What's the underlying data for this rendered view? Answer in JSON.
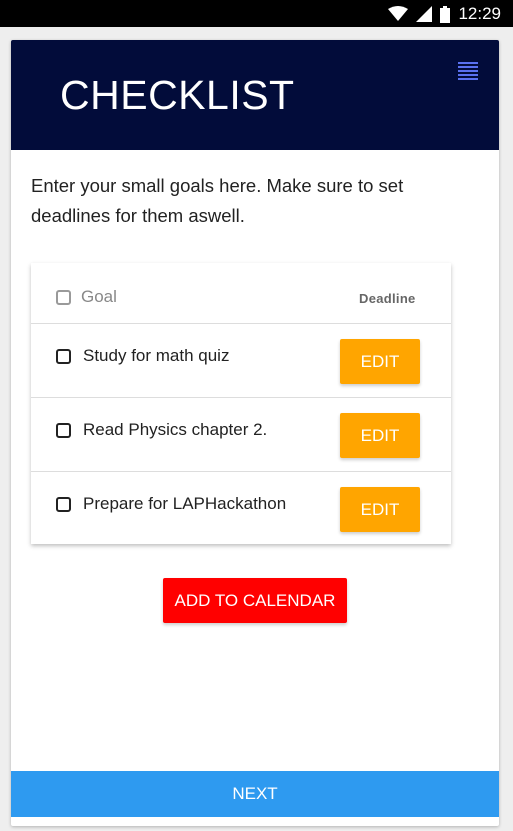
{
  "status_bar": {
    "time": "12:29",
    "icons": [
      "wifi-icon",
      "signal-icon",
      "battery-icon"
    ]
  },
  "app": {
    "title": "CHECKLIST",
    "menu_icon": "menu-icon"
  },
  "intro_text": "Enter your small goals here. Make sure to set deadlines for them aswell.",
  "table": {
    "goal_header": "Goal",
    "deadline_header": "Deadline",
    "rows": [
      {
        "goal": "Study for math quiz",
        "action": "EDIT"
      },
      {
        "goal": "Read Physics chapter 2.",
        "action": "EDIT"
      },
      {
        "goal": "Prepare for LAPHackathon",
        "action": "EDIT"
      }
    ]
  },
  "buttons": {
    "add_to_calendar": "ADD TO CALENDAR",
    "next": "NEXT"
  },
  "colors": {
    "appbar": "#020c3a",
    "menu_icon": "#5a71f0",
    "edit_button": "#ffa500",
    "add_calendar_button": "#ff0000",
    "next_button": "#2e9af0"
  }
}
